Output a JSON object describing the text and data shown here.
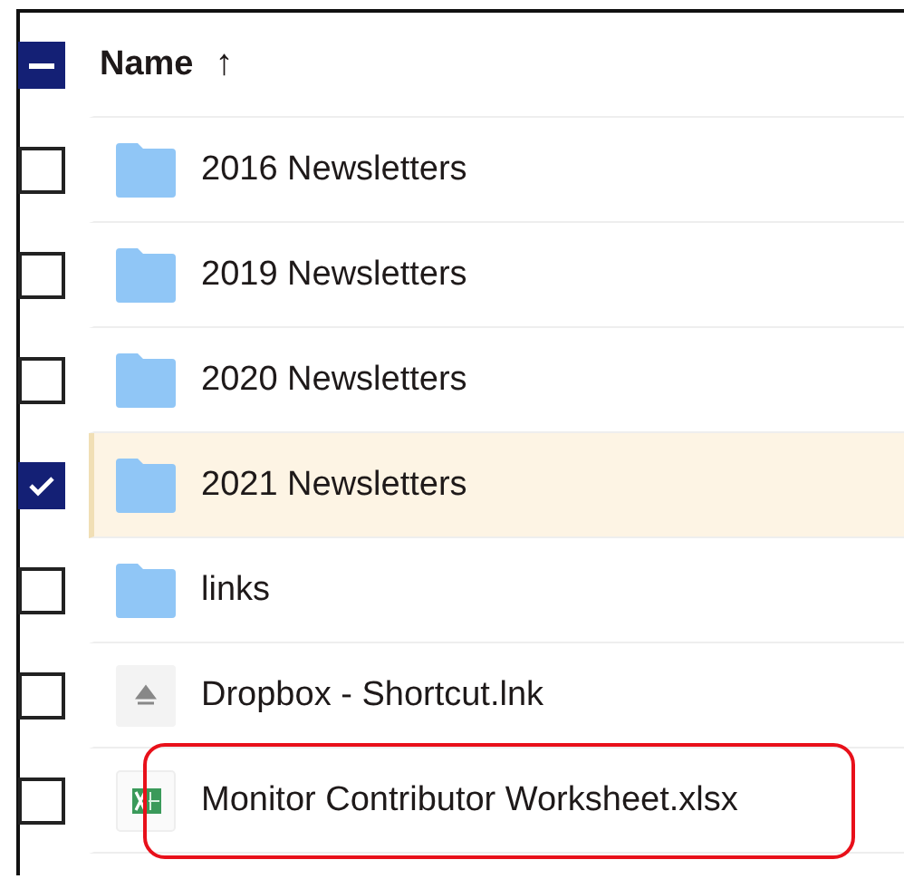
{
  "header": {
    "select_all": {
      "indeterminate": true
    },
    "label": "Name",
    "sort_indicator": "↑"
  },
  "rows": [
    {
      "name": "2016 Newsletters",
      "kind": "folder",
      "selected": false,
      "highlighted": false
    },
    {
      "name": "2019 Newsletters",
      "kind": "folder",
      "selected": false,
      "highlighted": false
    },
    {
      "name": "2020 Newsletters",
      "kind": "folder",
      "selected": false,
      "highlighted": false
    },
    {
      "name": "2021 Newsletters",
      "kind": "folder",
      "selected": true,
      "highlighted": false
    },
    {
      "name": "links",
      "kind": "folder",
      "selected": false,
      "highlighted": false
    },
    {
      "name": "Dropbox - Shortcut.lnk",
      "kind": "shortcut",
      "selected": false,
      "highlighted": false
    },
    {
      "name": "Monitor Contributor Worksheet.xlsx",
      "kind": "spreadsheet",
      "selected": false,
      "highlighted": true
    }
  ]
}
